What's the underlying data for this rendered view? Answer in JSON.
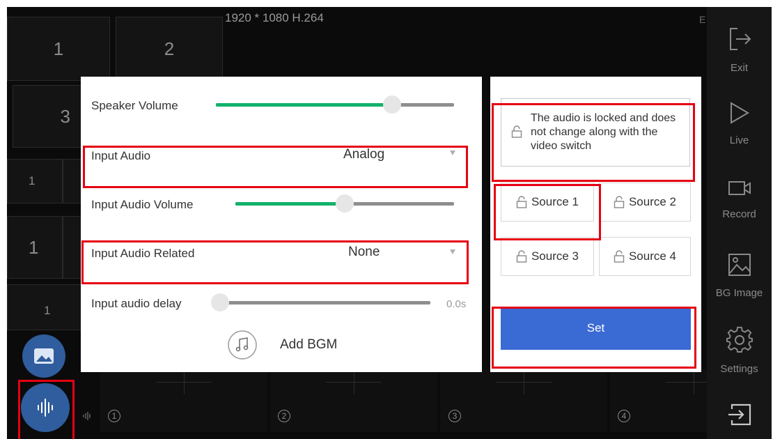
{
  "stream_info": "1920 * 1080 H.264",
  "corner_text": "E",
  "layout_tiles": [
    "1",
    "2",
    "3",
    "1",
    "1",
    "1"
  ],
  "sidebar": {
    "items": [
      {
        "label": "Exit",
        "icon": "exit-icon"
      },
      {
        "label": "Live",
        "icon": "play-icon"
      },
      {
        "label": "Record",
        "icon": "video-camera-icon"
      },
      {
        "label": "BG Image",
        "icon": "image-icon"
      },
      {
        "label": "Settings",
        "icon": "gear-icon"
      }
    ]
  },
  "bottom_strip": {
    "numbers": [
      "1",
      "2",
      "3",
      "4"
    ]
  },
  "audio_panel": {
    "speaker_volume": {
      "label": "Speaker Volume",
      "level": 0.74
    },
    "input_audio": {
      "label": "Input Audio",
      "value": "Analog"
    },
    "input_audio_volume": {
      "label": "Input Audio Volume",
      "level": 0.5
    },
    "input_audio_related": {
      "label": "Input Audio Related",
      "value": "None"
    },
    "input_audio_delay": {
      "label": "Input audio delay",
      "value": "0.0s",
      "level": 0.0
    },
    "add_bgm_label": "Add BGM"
  },
  "source_panel": {
    "lock_message": "The audio is locked and does not change along with the video switch",
    "sources": [
      "Source 1",
      "Source 2",
      "Source 3",
      "Source 4"
    ],
    "set_label": "Set"
  },
  "colors": {
    "accent_green": "#12b26b",
    "button_blue": "#3a6ad4",
    "highlight_red": "#e60012"
  }
}
